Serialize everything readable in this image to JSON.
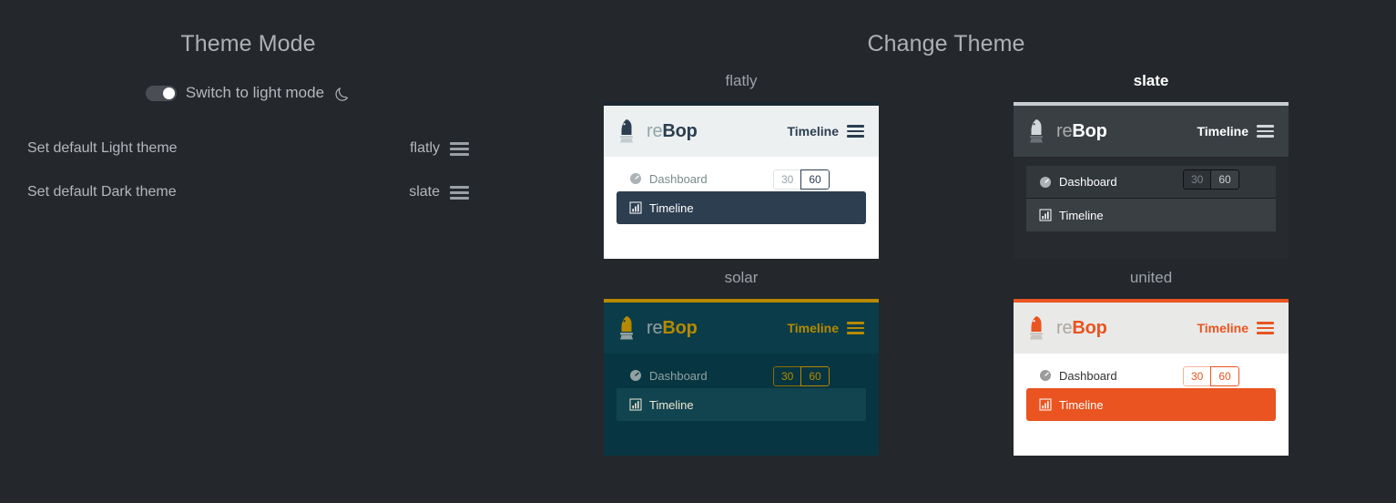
{
  "theme_mode": {
    "title": "Theme Mode",
    "toggle": {
      "label": "Switch to light mode",
      "state": "on",
      "icon": "moon-icon"
    },
    "settings": [
      {
        "label": "Set default Light theme",
        "value": "flatly",
        "icon": "hamburger-icon"
      },
      {
        "label": "Set default Dark theme",
        "value": "slate",
        "icon": "hamburger-icon"
      }
    ]
  },
  "change_theme": {
    "title": "Change Theme",
    "themes": [
      {
        "name": "flatly",
        "active": false,
        "preview": {
          "brand_re": "re",
          "brand_bop": "Bop",
          "nav_link": "Timeline",
          "nav_icon": "hamburger-icon",
          "logo_icon": "chess-knight-icon",
          "sidebar": [
            {
              "label": "Dashboard",
              "icon": "gauge-icon",
              "selected": false
            },
            {
              "label": "Timeline",
              "icon": "bar-chart-icon",
              "selected": true
            }
          ],
          "range_buttons": [
            {
              "label": "30",
              "selected": false
            },
            {
              "label": "60",
              "selected": true
            }
          ]
        }
      },
      {
        "name": "slate",
        "active": true,
        "preview": {
          "brand_re": "re",
          "brand_bop": "Bop",
          "nav_link": "Timeline",
          "nav_icon": "hamburger-icon",
          "logo_icon": "chess-knight-icon",
          "sidebar": [
            {
              "label": "Dashboard",
              "icon": "gauge-icon",
              "selected": false
            },
            {
              "label": "Timeline",
              "icon": "bar-chart-icon",
              "selected": true
            }
          ],
          "range_buttons": [
            {
              "label": "30",
              "selected": false
            },
            {
              "label": "60",
              "selected": true
            }
          ]
        }
      },
      {
        "name": "solar",
        "active": false,
        "preview": {
          "brand_re": "re",
          "brand_bop": "Bop",
          "nav_link": "Timeline",
          "nav_icon": "hamburger-icon",
          "logo_icon": "chess-knight-icon",
          "sidebar": [
            {
              "label": "Dashboard",
              "icon": "gauge-icon",
              "selected": false
            },
            {
              "label": "Timeline",
              "icon": "bar-chart-icon",
              "selected": true
            }
          ],
          "range_buttons": [
            {
              "label": "30",
              "selected": false
            },
            {
              "label": "60",
              "selected": true
            }
          ]
        }
      },
      {
        "name": "united",
        "active": false,
        "preview": {
          "brand_re": "re",
          "brand_bop": "Bop",
          "nav_link": "Timeline",
          "nav_icon": "hamburger-icon",
          "logo_icon": "chess-knight-icon",
          "sidebar": [
            {
              "label": "Dashboard",
              "icon": "gauge-icon",
              "selected": false
            },
            {
              "label": "Timeline",
              "icon": "bar-chart-icon",
              "selected": true
            }
          ],
          "range_buttons": [
            {
              "label": "30",
              "selected": false
            },
            {
              "label": "60",
              "selected": true
            }
          ]
        }
      }
    ]
  },
  "colors": {
    "page_background": "#24272b",
    "text_muted": "#b4b8bd",
    "flatly_accent": "#2c3e50",
    "slate_accent": "#3a3f44",
    "solar_accent": "#b58900",
    "united_accent": "#e95420"
  }
}
